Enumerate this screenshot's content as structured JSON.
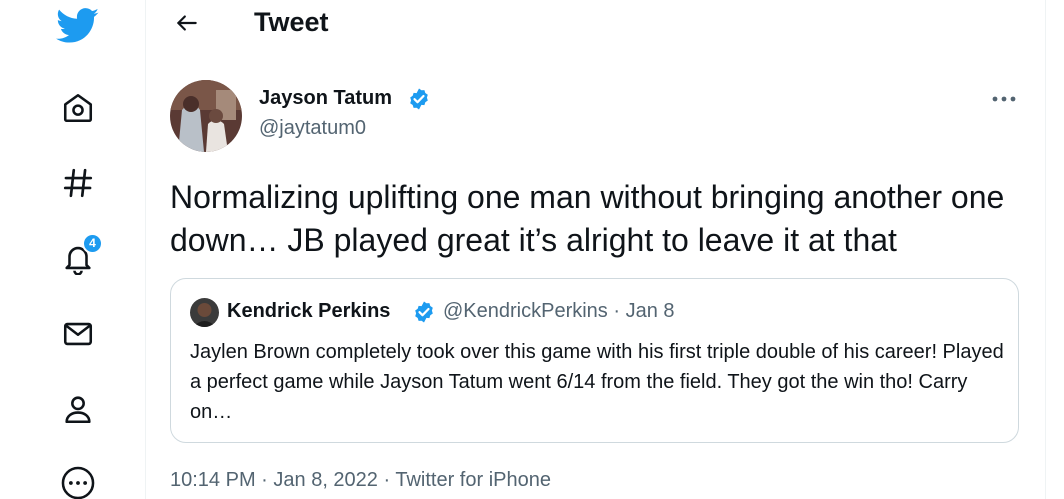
{
  "header": {
    "title": "Tweet"
  },
  "sidebar": {
    "items": [
      {
        "icon": "twitter-bird-icon"
      },
      {
        "icon": "home-icon"
      },
      {
        "icon": "hashtag-icon"
      },
      {
        "icon": "bell-icon",
        "badge": "4"
      },
      {
        "icon": "mail-icon"
      },
      {
        "icon": "person-icon"
      },
      {
        "icon": "more-circle-icon"
      }
    ]
  },
  "tweet": {
    "author_name": "Jayson Tatum",
    "author_handle": "@jaytatum0",
    "text": "Normalizing uplifting one man without bringing another one down… JB played great it’s alright to leave it at that",
    "time": "10:14 PM",
    "date": "Jan 8, 2022",
    "source": "Twitter for iPhone",
    "sep": " · "
  },
  "quote": {
    "author_name": "Kendrick Perkins",
    "author_handle": "@KendrickPerkins",
    "date": "Jan 8",
    "meta": "@KendrickPerkins · Jan 8",
    "text": "Jaylen Brown completely took over this game with his first triple double of his career! Played a perfect game while Jayson Tatum went 6/14 from the field. They got the win tho! Carry on…"
  },
  "colors": {
    "accent": "#1d9bf0",
    "text": "#0f1419",
    "secondary": "#536471",
    "border": "#cfd9de"
  }
}
